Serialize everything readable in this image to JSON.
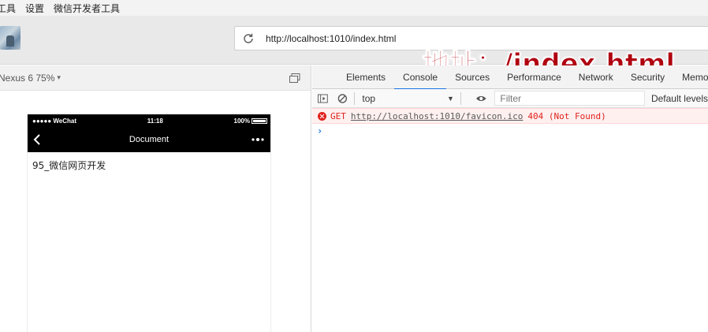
{
  "menu": {
    "items": [
      "工具",
      "设置",
      "微信开发者工具"
    ]
  },
  "toolbar": {
    "url": "http://localhost:1010/index.html",
    "overlay_caption": "地址：/index.html"
  },
  "simulator": {
    "device": "Nexus 6 75%",
    "status_bar": {
      "carrier": "●●●●● WeChat",
      "time": "11:18",
      "battery": "100%"
    },
    "nav_title": "Document",
    "content_text": "95_微信网页开发"
  },
  "devtools": {
    "tabs": [
      {
        "label": "Elements",
        "active": false
      },
      {
        "label": "Console",
        "active": true
      },
      {
        "label": "Sources",
        "active": false
      },
      {
        "label": "Performance",
        "active": false
      },
      {
        "label": "Network",
        "active": false
      },
      {
        "label": "Security",
        "active": false
      },
      {
        "label": "Memory",
        "active": false
      }
    ],
    "console": {
      "context": "top",
      "filter_placeholder": "Filter",
      "levels_label": "Default levels",
      "messages": [
        {
          "type": "error",
          "method": "GET",
          "url": "http://localhost:1010/favicon.ico",
          "status": "404 (Not Found)"
        }
      ],
      "prompt": "›"
    }
  },
  "colors": {
    "active_tab_underline": "#1a73e8",
    "error_red": "#e0221b",
    "caption_red": "#b00010"
  }
}
